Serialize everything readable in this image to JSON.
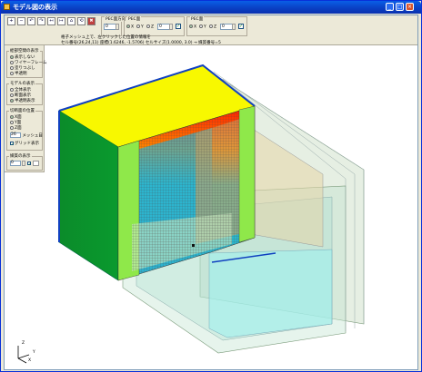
{
  "window": {
    "title": "モデル図の表示",
    "min": "_",
    "max": "□",
    "close": "×"
  },
  "toolbar": {
    "icons": [
      "zoom-in-icon",
      "zoom-out-icon",
      "rotate-left-icon",
      "rotate-right-icon",
      "undo-icon",
      "redo-icon",
      "home-icon",
      "reset-view-icon",
      "close-view-icon"
    ],
    "icon_glyphs": [
      "+",
      "−",
      "↶",
      "↷",
      "↤",
      "↦",
      "⌂",
      "⟲",
      "✖"
    ],
    "pec_dir": {
      "label": "PEC面方向",
      "value": "0"
    },
    "pec1": {
      "label": "PEC面",
      "options": [
        "X",
        "Y",
        "Z"
      ],
      "selected": "X",
      "value": "0"
    },
    "pec2": {
      "label": "PEC面",
      "options": [
        "X",
        "Y",
        "Z"
      ],
      "selected": "X",
      "value": "0"
    }
  },
  "info": {
    "line1": "格子メッシュ上で、左クリックした位置の情報を",
    "line2": "セル番号(26,24,11)  座標(1.6246, -1.5706)  セルサイズ(1.0000, 3.0)  → 媒質番号=5"
  },
  "left_panel": {
    "group1": {
      "label": "絵部空間の表示",
      "items": [
        "表示しない",
        "ワイヤーフレーム",
        "塗りつぶし",
        "半透明"
      ],
      "selected": 0
    },
    "group2": {
      "label": "モデルの表示",
      "items": [
        "全体表示",
        "断面表示",
        "半透明表示"
      ],
      "selected": 2
    },
    "group3": {
      "label": "切断面の位置",
      "items": [
        "X面",
        "Y面",
        "Z面"
      ],
      "selected": 0
    },
    "slice": {
      "value": "26",
      "suffix": "メッシュ目"
    },
    "grid_toggle": {
      "label": "グリッド表示",
      "checked": true
    },
    "group4": {
      "label": "媒質の表示",
      "value": "0"
    }
  },
  "axis": {
    "x": "X",
    "y": "Y",
    "z": "Z"
  },
  "colors": {
    "yellow": "#f8f800",
    "green": "#0a9a2a",
    "blue": "#1040c0",
    "cyan": "#9ff0ef"
  }
}
